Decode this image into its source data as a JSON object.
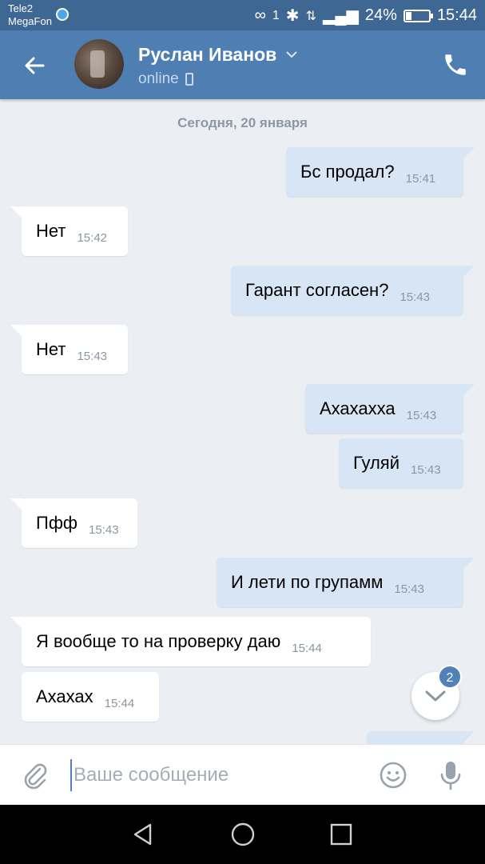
{
  "status_bar": {
    "carrier1": "Tele2",
    "carrier2": "MegaFon",
    "sim_index": "1",
    "battery": "24%",
    "battery_level": 0.24,
    "time": "15:44"
  },
  "header": {
    "contact_name": "Руслан Иванов",
    "presence": "online",
    "icons": [
      "back-arrow-icon",
      "chevron-down-icon",
      "mobile-device-icon",
      "phone-icon"
    ]
  },
  "chat": {
    "date_separator": "Сегодня, 20 января",
    "messages": [
      {
        "direction": "out",
        "text": "Бс продал?",
        "time": "15:41"
      },
      {
        "direction": "in",
        "text": "Нет",
        "time": "15:42"
      },
      {
        "direction": "out",
        "text": "Гарант согласен?",
        "time": "15:43"
      },
      {
        "direction": "in",
        "text": "Нет",
        "time": "15:43"
      },
      {
        "direction": "out",
        "text": "Ахахахха",
        "time": "15:43"
      },
      {
        "direction": "out",
        "text": "Гуляй",
        "time": "15:43"
      },
      {
        "direction": "in",
        "text": "Пфф",
        "time": "15:43"
      },
      {
        "direction": "out",
        "text": "И лети по групамм",
        "time": "15:43"
      },
      {
        "direction": "in",
        "text": "Я вообще то на проверку даю",
        "time": "15:44"
      },
      {
        "direction": "in",
        "text": "Ахахах",
        "time": "15:44"
      }
    ],
    "unread_badge": "2"
  },
  "composer": {
    "placeholder": "Ваше сообщение",
    "value": ""
  },
  "colors": {
    "status_bar": "#3e6794",
    "header": "#4f7fb2",
    "chat_bg": "#ebeef2",
    "outgoing_bubble": "#d7e5f5",
    "incoming_bubble": "#ffffff",
    "accent": "#5181b8"
  }
}
